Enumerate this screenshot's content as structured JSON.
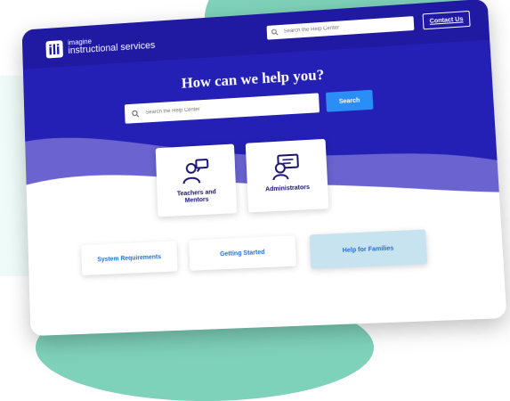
{
  "header": {
    "logo_small": "imagine",
    "logo_text": "instructional services",
    "search_placeholder": "Search the Help Center",
    "contact_label": "Contact Us"
  },
  "hero": {
    "headline": "How can we help you?",
    "search_placeholder": "Search the Help Center",
    "search_button": "Search"
  },
  "roles": [
    {
      "label": "Teachers and Mentors",
      "icon": "teacher-icon"
    },
    {
      "label": "Administrators",
      "icon": "administrator-icon"
    }
  ],
  "links": [
    {
      "label": "System Requirements"
    },
    {
      "label": "Getting Started"
    },
    {
      "label": "Help for Families"
    }
  ],
  "colors": {
    "hero": "#2420b5",
    "topbar": "#1f1aa1",
    "wave": "#6a63d0",
    "button": "#2b8ef7",
    "link_text": "#1e6fd9",
    "families_card": "#c8e3f0"
  }
}
